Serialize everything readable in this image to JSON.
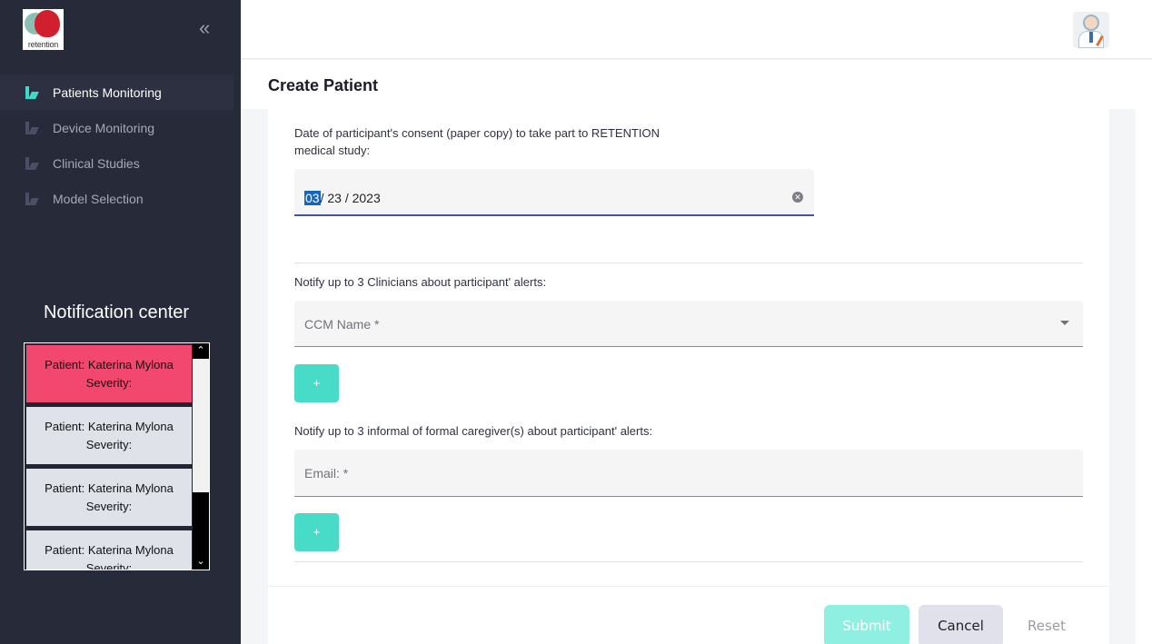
{
  "sidebar": {
    "logo_text": "retention",
    "collapse_icon": "chevron-double-left-icon",
    "nav": [
      {
        "label": "Patients Monitoring",
        "active": true
      },
      {
        "label": "Device Monitoring",
        "active": false
      },
      {
        "label": "Clinical Studies",
        "active": false
      },
      {
        "label": "Model Selection",
        "active": false
      }
    ],
    "notification_title": "Notification center",
    "notifications": [
      {
        "patient": "Patient: Katerina Mylona",
        "severity": "Severity:",
        "color": "#f2486f"
      },
      {
        "patient": "Patient: Katerina Mylona",
        "severity": "Severity:",
        "color": "#e0e2ea"
      },
      {
        "patient": "Patient: Katerina Mylona",
        "severity": "Severity:",
        "color": "#e0e2ea"
      },
      {
        "patient": "Patient: Katerina Mylona",
        "severity": "Severity:",
        "color": "#e0e2ea"
      }
    ]
  },
  "header": {
    "page_title": "Create Patient",
    "avatar_icon": "doctor-avatar-icon"
  },
  "form": {
    "consent_label": "Date of participant's consent (paper copy) to take part to RETENTION medical study:",
    "consent_label_line1": "Date of participant's consent (paper copy) to take part to RETENTION",
    "consent_label_line2": "medical study:",
    "date": {
      "month": "03",
      "sep1": "/",
      "day": "23",
      "sep2": "/",
      "year": "2023"
    },
    "clinicians_label": "Notify up to 3 Clinicians about participant' alerts:",
    "ccm_placeholder": "CCM Name *",
    "add_label": "+",
    "caregivers_label": "Notify up to 3 informal of formal caregiver(s) about participant' alerts:",
    "email_placeholder": "Email: *",
    "buttons": {
      "submit": "Submit",
      "cancel": "Cancel",
      "reset": "Reset"
    }
  },
  "colors": {
    "sidebar_bg": "#272a38",
    "accent_teal": "#48dcc8",
    "alert_pink": "#f2486f",
    "focus_underline": "#3f51b5"
  }
}
